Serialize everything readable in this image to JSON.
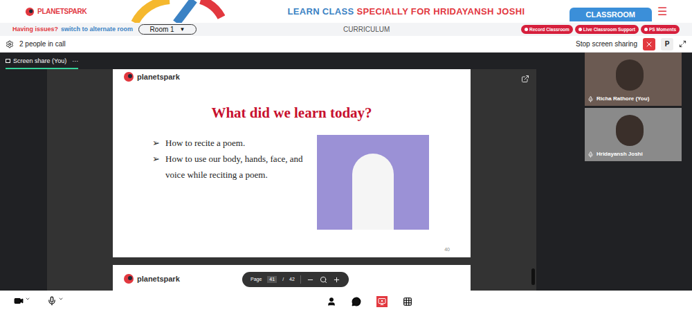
{
  "header": {
    "logo": "PLANETSPARK",
    "title_lead": "LEARN CLASS",
    "title_rest": "SPECIALLY FOR HRIDAYANSH JOSHI",
    "classroom_tab": "CLASSROOM",
    "menu_glyph": "☰"
  },
  "subbar": {
    "issue_text": "Having issues?",
    "issue_link": "switch to alternate room",
    "room": "Room 1",
    "room_caret": "▼",
    "curriculum": "CURRICULUM",
    "buttons": [
      "Record Classroom",
      "Live Classroom Support",
      "PS Moments"
    ]
  },
  "call_bar": {
    "people": "2 people in call",
    "stop_sharing": "Stop screen sharing",
    "p_button": "P"
  },
  "tabs": [
    {
      "label": "Screen share (You)",
      "more": "···",
      "selected": true
    }
  ],
  "slides": [
    {
      "logo": "planetspark",
      "title": "What did we learn today?",
      "bullet_glyph": "➢",
      "bullets": [
        "How to recite a poem.",
        "How to use our body, hands, face, and voice while reciting a poem."
      ],
      "number": "40"
    },
    {
      "logo": "planetspark"
    }
  ],
  "pager": {
    "label": "Page",
    "current": "41",
    "separator": "/",
    "total": "42"
  },
  "participants": [
    {
      "name": "Richa Rathore (You)"
    },
    {
      "name": "Hridayansh Joshi"
    }
  ],
  "toolbar": {
    "screen_share_active": true
  }
}
